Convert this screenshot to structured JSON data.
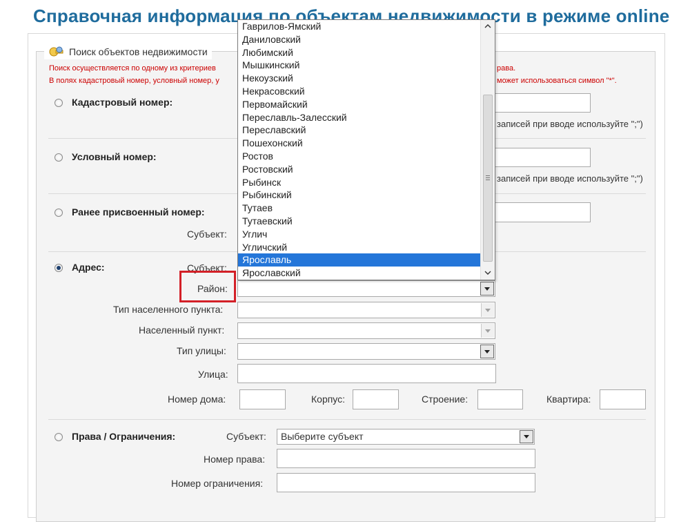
{
  "page": {
    "title": "Справочная информация по объектам недвижимости в режиме online"
  },
  "search": {
    "legend": "Поиск объектов недвижимости",
    "note1_left": "Поиск осуществляется по одному из критериев",
    "note1_right": "рава.",
    "note2_left": "В полях кадастровый номер, условный номер, у",
    "note2_right": "может использоваться символ \"*\"."
  },
  "cadastral": {
    "label": "Кадастровый номер:",
    "hint": "записей при вводе используйте \";\")",
    "value": ""
  },
  "conditional": {
    "label": "Условный номер:",
    "hint": "записей при вводе используйте \";\")",
    "value": ""
  },
  "previous": {
    "label": "Ранее присвоенный номер:",
    "subject_label": "Субъект:",
    "value": ""
  },
  "address": {
    "label": "Адрес:",
    "subject_label": "Субъект:",
    "district_label": "Район:",
    "district_value": "",
    "settlement_type_label": "Тип населенного пункта:",
    "settlement_label": "Населенный пункт:",
    "street_type_label": "Тип улицы:",
    "street_label": "Улица:",
    "house_label": "Номер дома:",
    "building_label": "Корпус:",
    "structure_label": "Строение:",
    "apartment_label": "Квартира:"
  },
  "rights": {
    "label": "Права / Ограничения:",
    "subject_label": "Субъект:",
    "subject_value": "Выберите субъект",
    "right_number_label": "Номер права:",
    "restriction_number_label": "Номер ограничения:"
  },
  "district_dropdown": {
    "options": [
      "Гаврилов-Ямский",
      "Даниловский",
      "Любимский",
      "Мышкинский",
      "Некоузский",
      "Некрасовский",
      "Первомайский",
      "Переславль-Залесский",
      "Переславский",
      "Пошехонский",
      "Ростов",
      "Ростовский",
      "Рыбинск",
      "Рыбинский",
      "Тутаев",
      "Тутаевский",
      "Углич",
      "Угличский",
      "Ярославль",
      "Ярославский"
    ],
    "highlighted": "Ярославль"
  },
  "colors": {
    "title": "#1f6c9d",
    "note": "#cc0000",
    "highlight": "#2476d9",
    "callout": "#d32027"
  }
}
